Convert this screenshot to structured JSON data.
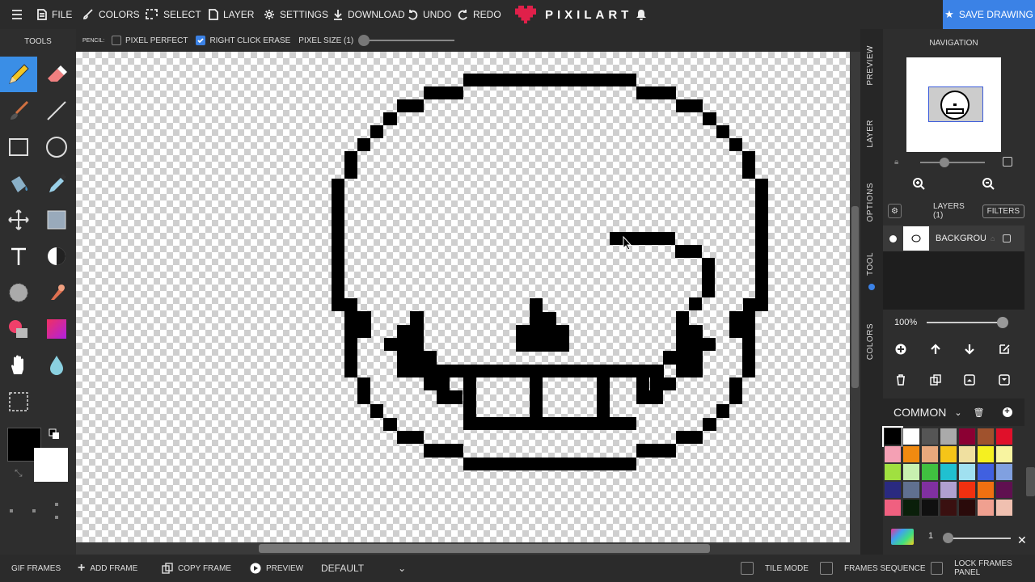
{
  "topbar": {
    "file": "FILE",
    "colors": "COLORS",
    "select": "SELECT",
    "layer": "LAYER",
    "settings": "SETTINGS",
    "download": "DOWNLOAD",
    "undo": "UNDO",
    "redo": "REDO",
    "logo": "PIXILART",
    "save": "SAVE DRAWING"
  },
  "tools": {
    "title": "TOOLS",
    "items": [
      "pencil",
      "eraser",
      "brush",
      "line",
      "rectangle",
      "circle",
      "bucket",
      "eyedropper",
      "move",
      "select-area",
      "text",
      "lighten",
      "dither",
      "stamp",
      "shape-eraser",
      "gradient",
      "hand",
      "blur-drop",
      "marquee"
    ]
  },
  "options": {
    "tool_label": "PENCIL:",
    "pixel_perfect": "PIXEL PERFECT",
    "pixel_perfect_checked": false,
    "right_click_erase": "RIGHT CLICK ERASE",
    "right_click_erase_checked": true,
    "pixel_size": "PIXEL SIZE (1)"
  },
  "sidetabs": [
    "PREVIEW",
    "LAYER",
    "OPTIONS",
    "TOOL",
    "COLORS"
  ],
  "navigation": {
    "title": "NAVIGATION"
  },
  "layers": {
    "title": "LAYERS (1)",
    "filters": "FILTERS",
    "items": [
      {
        "name": "BACKGROUND"
      }
    ],
    "opacity": "100%"
  },
  "palette": {
    "name": "COMMON",
    "colors": [
      "#000000",
      "#ffffff",
      "#555555",
      "#aaaaaa",
      "#8b0033",
      "#a0522d",
      "#e0102a",
      "#f4a0b4",
      "#f08a10",
      "#e8a87c",
      "#f5c518",
      "#f0e0a0",
      "#f5f020",
      "#f8f4a0",
      "#a0e040",
      "#c8f0b0",
      "#40c040",
      "#20c0d0",
      "#a0e0f0",
      "#4060e0",
      "#80a0e0",
      "#2a2a80",
      "#607090",
      "#8030a0",
      "#b0a0d0",
      "#f03010",
      "#f07010",
      "#601050",
      "#f06080",
      "#0a1f0a",
      "#101010",
      "#3a1010",
      "#2a0a0a",
      "#f0a090",
      "#f0c0b0"
    ],
    "frame_number": "1"
  },
  "bottom": {
    "gif_frames": "GIF FRAMES",
    "add_frame": "ADD FRAME",
    "copy_frame": "COPY FRAME",
    "preview": "PREVIEW",
    "default": "DEFAULT",
    "tile_mode": "TILE MODE",
    "frames_sequence": "FRAMES SEQUENCE",
    "lock_frames_panel": "LOCK FRAMES PANEL"
  },
  "accent": "#3b82e6"
}
